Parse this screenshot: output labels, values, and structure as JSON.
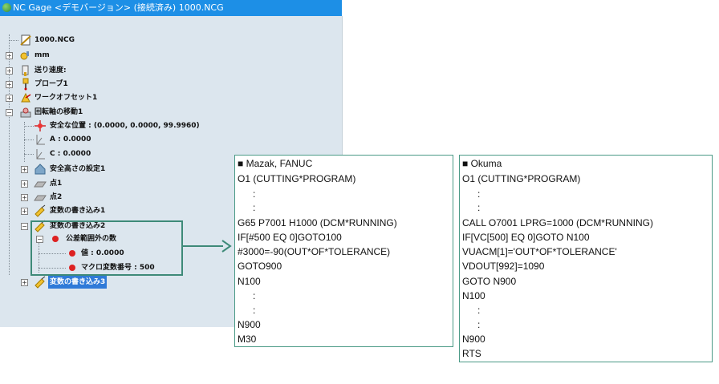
{
  "window": {
    "title": "NC Gage <デモバージョン> (接続済み) 1000.NCG"
  },
  "tree": [
    {
      "label": "1000.NCG",
      "icon": "file-ruler-icon"
    },
    {
      "label": "mm",
      "icon": "unit-key-icon"
    },
    {
      "label": "送り速度:",
      "icon": "feed-rate-icon"
    },
    {
      "label": "プローブ1",
      "icon": "probe-icon"
    },
    {
      "label": "ワークオフセット1",
      "icon": "work-offset-icon"
    },
    {
      "label": "回転軸の移動1",
      "icon": "rotary-axis-icon"
    },
    {
      "label": "安全な位置 : (0.0000, 0.0000, 99.9960)",
      "icon": "safe-position-icon"
    },
    {
      "label": "A : 0.0000",
      "icon": "axis-a-icon"
    },
    {
      "label": "C : 0.0000",
      "icon": "axis-c-icon"
    },
    {
      "label": "安全高さの設定1",
      "icon": "safe-height-icon"
    },
    {
      "label": "点1",
      "icon": "point-icon"
    },
    {
      "label": "点2",
      "icon": "point-icon"
    },
    {
      "label": "変数の書き込み1",
      "icon": "variable-write-icon"
    },
    {
      "label": "変数の書き込み2",
      "icon": "variable-write-icon"
    },
    {
      "label": "公差範囲外の数",
      "icon": "red-dot-icon"
    },
    {
      "label": "値 : 0.0000",
      "icon": "red-dot-icon"
    },
    {
      "label": "マクロ変数番号 : 500",
      "icon": "red-dot-icon"
    },
    {
      "label": "変数の書き込み3",
      "icon": "variable-write-icon"
    }
  ],
  "mazak": {
    "heading": "■ Mazak, FANUC",
    "lines": [
      "O1 (CUTTING*PROGRAM)",
      "  :",
      "  :",
      "G65 P7001 H1000 (DCM*RUNNING)",
      "IF[#500 EQ 0]GOTO100",
      "#3000=-90(OUT*OF*TOLERANCE)",
      "GOTO900",
      "N100",
      "  :",
      "  :",
      "N900",
      "M30"
    ]
  },
  "okuma": {
    "heading": "■ Okuma",
    "lines": [
      "O1 (CUTTING*PROGRAM)",
      "  :",
      "  :",
      "CALL O7001 LPRG=1000 (DCM*RUNNING)",
      "IF[VC[500] EQ 0]GOTO N100",
      "VUACM[1]='OUT*OF*TOLERANCE'",
      "VDOUT[992]=1090",
      "GOTO N900",
      "N100",
      "  :",
      "  :",
      "N900",
      "RTS"
    ]
  },
  "colors": {
    "accent": "#3e8a78",
    "titlebar": "#1d8fe6",
    "selection": "#2f7ad8",
    "tree_bg": "#dce6ee"
  }
}
